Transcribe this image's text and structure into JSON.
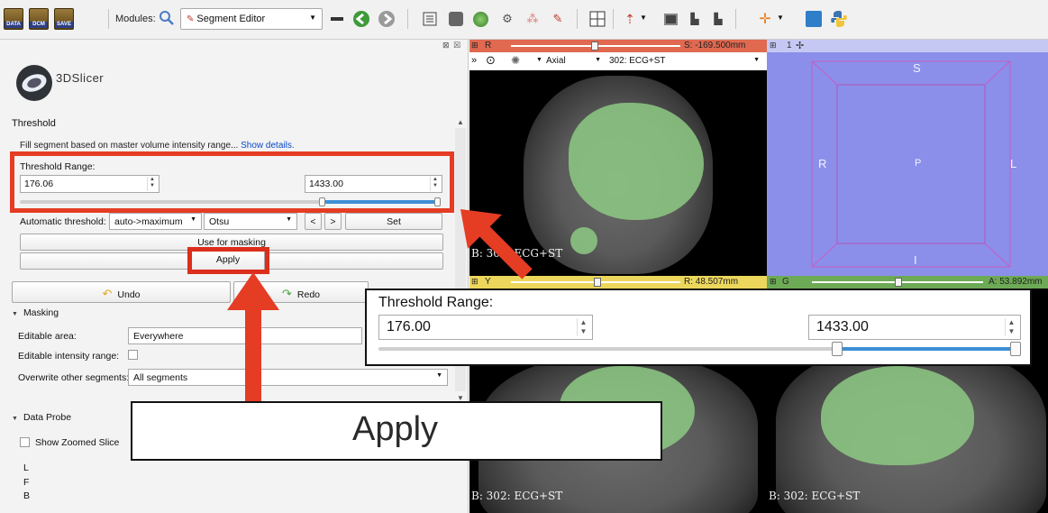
{
  "toolbar": {
    "data_label": "DATA",
    "dcm_label": "DCM",
    "save_label": "SAVE",
    "modules_label": "Modules:",
    "module_selected": "Segment Editor"
  },
  "left_panel": {
    "app_name": "3DSlicer",
    "section_title": "Threshold",
    "description": "Fill segment based on master volume intensity range...",
    "show_details": "Show details.",
    "threshold_range_label": "Threshold Range:",
    "threshold_min": "176.06",
    "threshold_max": "1433.00",
    "auto_threshold_label": "Automatic threshold:",
    "auto_threshold_mode": "auto->maximum",
    "auto_threshold_method": "Otsu",
    "prev_label": "<",
    "next_label": ">",
    "set_label": "Set",
    "use_for_masking_label": "Use for masking",
    "apply_label": "Apply",
    "undo_label": "Undo",
    "redo_label": "Redo",
    "masking_title": "Masking",
    "editable_area_label": "Editable area:",
    "editable_area_value": "Everywhere",
    "editable_intensity_label": "Editable intensity range:",
    "overwrite_label": "Overwrite other segments:",
    "overwrite_value": "All segments",
    "data_probe_title": "Data Probe",
    "show_zoomed_label": "Show Zoomed Slice",
    "probe_l": "L",
    "probe_f": "F",
    "probe_b": "B"
  },
  "views": {
    "red_letter": "R",
    "red_offset": "S: -169.500mm",
    "red_orientation": "Axial",
    "red_volume": "302: ECG+ST",
    "red_label": "B: 302: ECG+ST",
    "threed_number": "1",
    "orient_s": "S",
    "orient_r": "R",
    "orient_p": "P",
    "orient_l": "L",
    "orient_i": "I",
    "yellow_letter": "Y",
    "yellow_offset": "R: 48.507mm",
    "green_letter": "G",
    "green_offset": "A: 53.892mm",
    "yellow_label": "B: 302: ECG+ST",
    "green_label": "B: 302: ECG+ST"
  },
  "zoom": {
    "threshold_range_label": "Threshold Range:",
    "threshold_min": "176.00",
    "threshold_max": "1433.00",
    "apply_label": "Apply"
  },
  "colors": {
    "highlight": "#e53c24",
    "red_view": "#e06950",
    "yellow_view": "#ecd75c",
    "green_view": "#6daa55",
    "threed_bg": "#8b8fea"
  }
}
